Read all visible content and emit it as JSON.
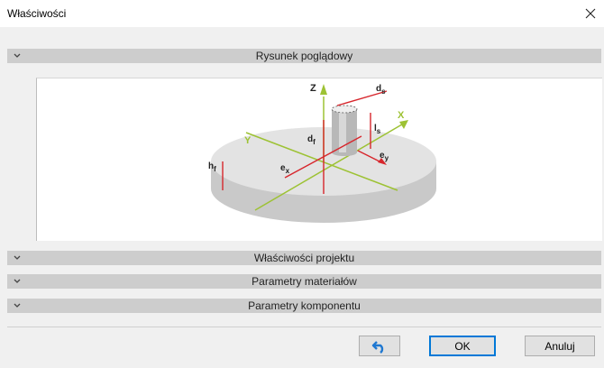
{
  "window": {
    "title": "Właściwości"
  },
  "sections": {
    "drawing": "Rysunek poglądowy",
    "project": "Właściwości projektu",
    "material": "Parametry materiałów",
    "component": "Parametry komponentu"
  },
  "drawing": {
    "labels": {
      "z": "Z",
      "x": "X",
      "y": "Y",
      "ds": "d",
      "ds_sub": "s",
      "ls": "l",
      "ls_sub": "s",
      "df": "d",
      "df_sub": "f",
      "hf": "h",
      "hf_sub": "f",
      "ex": "e",
      "ex_sub": "x",
      "ey": "e",
      "ey_sub": "y"
    },
    "colors": {
      "axis": "#9dc234",
      "dimension": "#d7262c",
      "disc": "#dcdcdc"
    }
  },
  "buttons": {
    "undo_icon": "undo-icon",
    "ok": "OK",
    "cancel": "Anuluj"
  }
}
